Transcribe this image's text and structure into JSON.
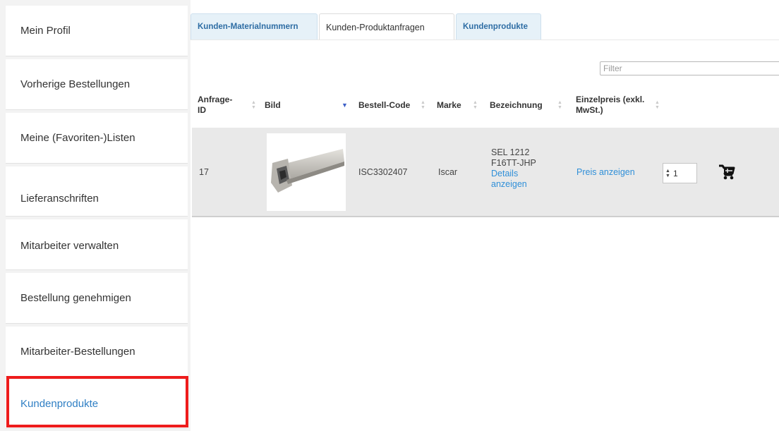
{
  "sidebar": {
    "items": [
      {
        "label": "Mein Profil"
      },
      {
        "label": "Vorherige Bestellungen"
      },
      {
        "label": "Meine (Favoriten-)Listen"
      },
      {
        "label": "Lieferanschriften"
      },
      {
        "label": "Mitarbeiter verwalten"
      },
      {
        "label": "Bestellung genehmigen"
      },
      {
        "label": "Mitarbeiter-Bestellungen"
      },
      {
        "label": "Kundenprodukte"
      }
    ],
    "active_index": 7,
    "highlight_color": "#ee1c1c"
  },
  "tabs": [
    {
      "label": "Kunden-Materialnummern"
    },
    {
      "label": "Kunden-Produktanfragen"
    },
    {
      "label": "Kundenprodukte"
    }
  ],
  "active_tab": 1,
  "filter": {
    "placeholder": "Filter",
    "value": ""
  },
  "table": {
    "headers": {
      "id_line1": "Anfrage-",
      "id_line2": "ID",
      "image": "Bild",
      "code": "Bestell-Code",
      "brand": "Marke",
      "name": "Bezeichnung",
      "price_line1": "Einzelpreis (exkl.",
      "price_line2": "MwSt.)"
    },
    "rows": [
      {
        "id": "17",
        "image_icon": "turning-tool-holder-image",
        "code": "ISC3302407",
        "brand": "Iscar",
        "name_line1": "SEL 1212",
        "name_line2": "F16TT-JHP",
        "details_line1": "Details",
        "details_line2": "anzeigen",
        "price_link": "Preis anzeigen",
        "quantity": "1",
        "cart_icon": "cart-icon"
      }
    ]
  },
  "colors": {
    "link": "#2f8fd8",
    "tab_text": "#2e6da4",
    "sort_active": "#3c5fc7"
  }
}
